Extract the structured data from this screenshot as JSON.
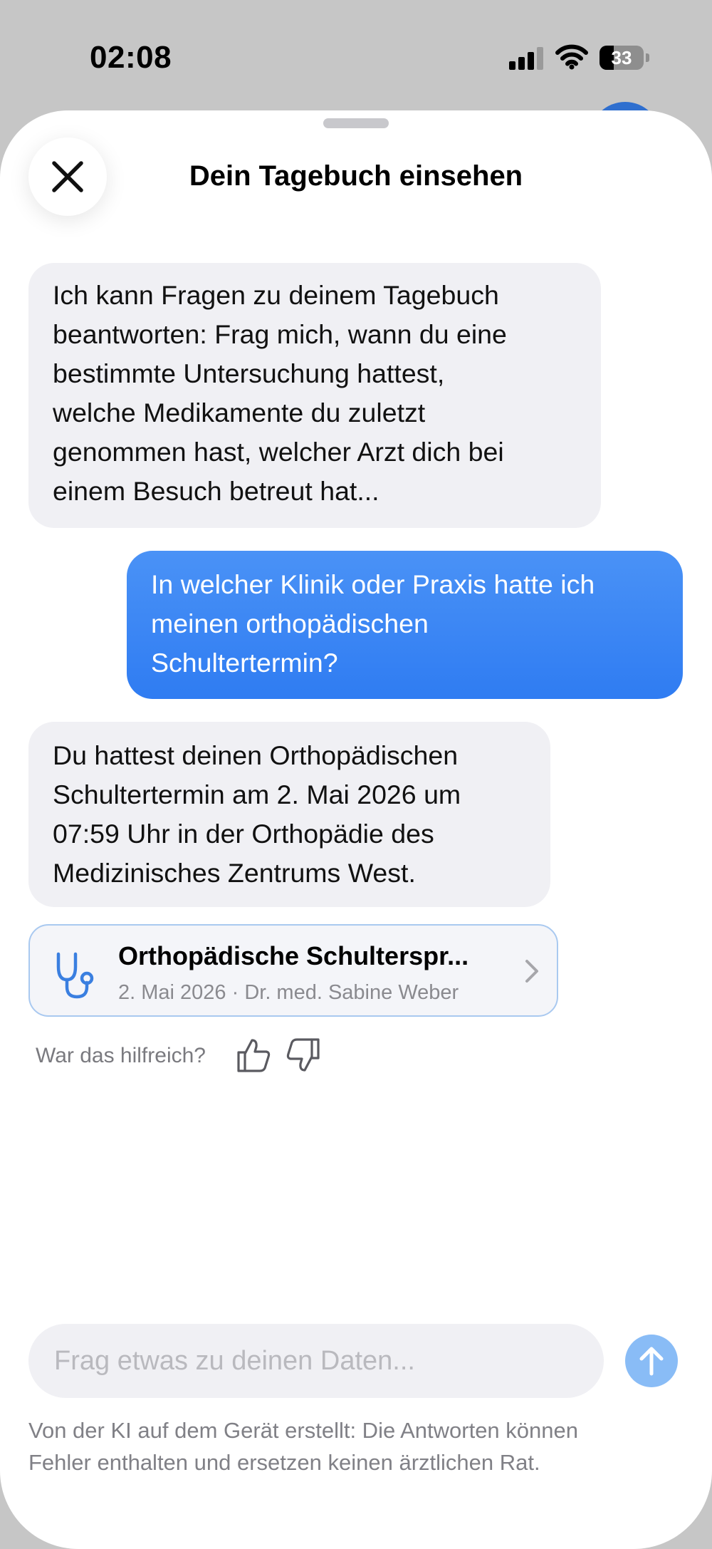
{
  "status_bar": {
    "time": "02:08",
    "battery_level": "33",
    "icons": [
      "signal-icon",
      "wifi-icon",
      "battery-icon"
    ]
  },
  "sheet": {
    "title": "Dein Tagebuch einsehen",
    "close_icon": "close-icon"
  },
  "messages": [
    {
      "role": "assistant",
      "lines": [
        "Ich kann Fragen zu deinem Tagebuch",
        "beantworten: Frag mich, wann du eine",
        "bestimmte Untersuchung hattest,",
        "welche Medikamente du zuletzt",
        "genommen hast, welcher Arzt dich bei",
        "einem Besuch betreut hat..."
      ]
    },
    {
      "role": "user",
      "lines": [
        "In welcher Klinik oder Praxis hatte ich",
        "meinen orthopädischen",
        "Schultertermin?"
      ]
    },
    {
      "role": "assistant",
      "lines": [
        "Du hattest deinen Orthopädischen",
        "Schultertermin am 2. Mai 2026 um",
        "07:59 Uhr in der Orthopädie des",
        "Medizinisches Zentrums West."
      ]
    }
  ],
  "source_card": {
    "icon": "stethoscope-icon",
    "title": "Orthopädische Schulterspr...",
    "subtitle": "2. Mai 2026 · Dr. med. Sabine Weber"
  },
  "feedback": {
    "label": "War das hilfreich?",
    "icons": [
      "thumbs-up-icon",
      "thumbs-down-icon"
    ]
  },
  "composer": {
    "placeholder": "Frag etwas zu deinen Daten...",
    "send_icon": "arrow-up-icon"
  },
  "disclaimer": {
    "lines": [
      "Von der KI auf dem Gerät erstellt: Die Antworten können",
      "Fehler enthalten und ersetzen keinen ärztlichen Rat."
    ]
  },
  "colors": {
    "accent": "#2f7cf2",
    "ai_bubble": "#f0f0f4",
    "send_disabled": "#89bcf6"
  }
}
